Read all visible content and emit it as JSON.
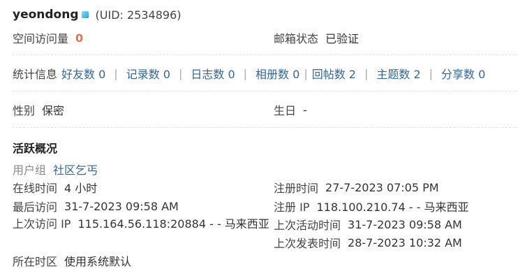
{
  "header": {
    "username": "yeondong",
    "status_icon": "online-status-icon",
    "uid": "(UID: 2534896)"
  },
  "profile": {
    "space_visits_label": "空间访问量",
    "space_visits_value": "0",
    "email_status_label": "邮箱状态",
    "email_status_value": "已验证",
    "stats_label": "统计信息",
    "stats": [
      {
        "label": "好友数 0"
      },
      {
        "label": "记录数 0"
      },
      {
        "label": "日志数 0"
      },
      {
        "label": "相册数 0"
      },
      {
        "label": "回帖数 2"
      },
      {
        "label": "主题数 2"
      },
      {
        "label": "分享数 0"
      }
    ],
    "gender_label": "性别",
    "gender_value": "保密",
    "birthday_label": "生日",
    "birthday_value": "-"
  },
  "activity": {
    "title": "活跃概况",
    "usergroup_label": "用户组",
    "usergroup_value": "社区乞丐",
    "online_time_label": "在线时间",
    "online_time_value": "4 小时",
    "register_time_label": "注册时间",
    "register_time_value": "27-7-2023 07:05 PM",
    "last_visit_label": "最后访问",
    "last_visit_value": "31-7-2023 09:58 AM",
    "register_ip_label": "注册 IP",
    "register_ip_value": "118.100.210.74 - - 马来西亚",
    "prev_visit_ip_label": "上次访问 IP",
    "prev_visit_ip_value": "115.164.56.118:20884 - - 马来西亚",
    "last_active_label": "上次活动时间",
    "last_active_value": "31-7-2023 09:58 AM",
    "last_post_label": "上次发表时间",
    "last_post_value": "28-7-2023 10:32 AM",
    "timezone_label": "所在时区",
    "timezone_value": "使用系统默认"
  }
}
